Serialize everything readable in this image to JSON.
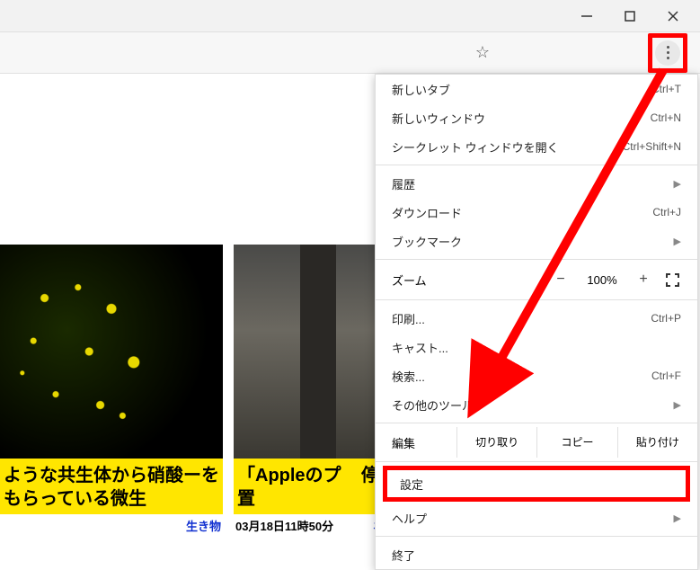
{
  "window": {
    "minimize_icon": "minimize-icon",
    "maximize_icon": "maximize-icon",
    "close_icon": "close-icon"
  },
  "toolbar": {
    "star_icon": "star-icon",
    "menu_icon": "kebab-menu-icon"
  },
  "menu": {
    "new_tab": {
      "label": "新しいタブ",
      "shortcut": "Ctrl+T"
    },
    "new_window": {
      "label": "新しいウィンドウ",
      "shortcut": "Ctrl+N"
    },
    "incognito": {
      "label": "シークレット ウィンドウを開く",
      "shortcut": "Ctrl+Shift+N"
    },
    "history": {
      "label": "履歴"
    },
    "downloads": {
      "label": "ダウンロード",
      "shortcut": "Ctrl+J"
    },
    "bookmarks": {
      "label": "ブックマーク"
    },
    "zoom": {
      "label": "ズーム",
      "minus": "−",
      "value": "100%",
      "plus": "+"
    },
    "print": {
      "label": "印刷...",
      "shortcut": "Ctrl+P"
    },
    "cast": {
      "label": "キャスト..."
    },
    "find": {
      "label": "検索...",
      "shortcut": "Ctrl+F"
    },
    "more_tools": {
      "label": "その他のツール"
    },
    "edit": {
      "label": "編集",
      "cut": "切り取り",
      "copy": "コピー",
      "paste": "貼り付け"
    },
    "settings": {
      "label": "設定"
    },
    "help": {
      "label": "ヘルプ"
    },
    "exit": {
      "label": "終了"
    }
  },
  "cards": [
    {
      "title": "ような共生体から硝酸ーをもらっている微生",
      "date": "",
      "category": "生き物"
    },
    {
      "title": "「Appleのプ    停止する措置",
      "date": "03月18日11時50分",
      "category": "ネットサービス"
    }
  ],
  "annotation": {
    "highlight_color": "#ff0000"
  }
}
